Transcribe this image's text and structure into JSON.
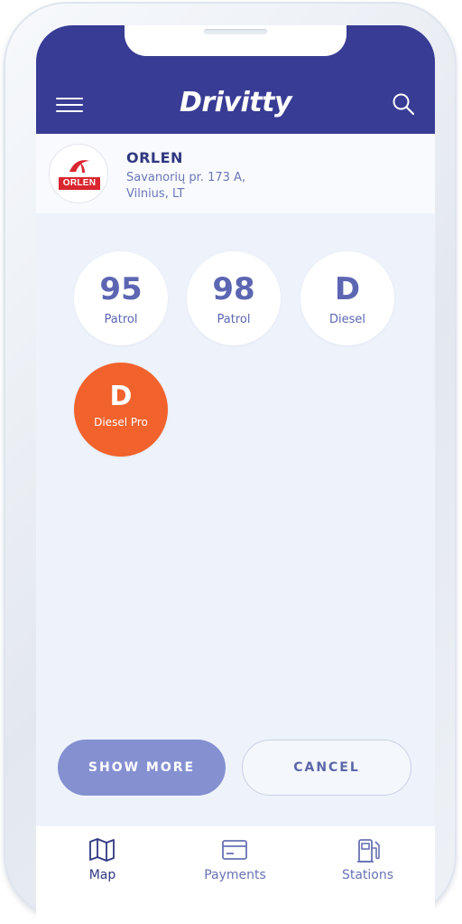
{
  "header": {
    "app_name": "Drivitty"
  },
  "station": {
    "logo_text": "ORLEN",
    "name": "ORLEN",
    "address_line1": "Savanorių pr. 173 A,",
    "address_line2": "Vilnius, LT"
  },
  "fuels": [
    {
      "code": "95",
      "label": "Patrol",
      "selected": false
    },
    {
      "code": "98",
      "label": "Patrol",
      "selected": false
    },
    {
      "code": "D",
      "label": "Diesel",
      "selected": false
    },
    {
      "code": "D",
      "label": "Diesel Pro",
      "selected": true
    }
  ],
  "buttons": {
    "show_more": "SHOW MORE",
    "cancel": "CANCEL"
  },
  "tabs": [
    {
      "label": "Map",
      "icon": "map-icon",
      "active": true
    },
    {
      "label": "Payments",
      "icon": "card-icon",
      "active": false
    },
    {
      "label": "Stations",
      "icon": "fuel-pump-icon",
      "active": false
    }
  ],
  "colors": {
    "header": "#383c94",
    "accent_orange": "#f2622c",
    "primary_button": "#8590d1"
  }
}
